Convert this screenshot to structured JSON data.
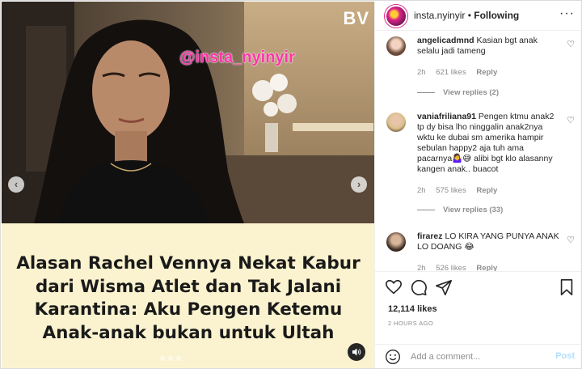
{
  "media": {
    "logo": "BV",
    "watermark": "@insta_nyinyir",
    "headline_lines": [
      "Alasan Rachel Vennya Nekat Kabur",
      "dari Wisma Atlet dan Tak Jalani",
      "Karantina: Aku Pengen Ketemu",
      "Anak-anak bukan untuk Ultah"
    ],
    "arrow_left": "‹",
    "arrow_right": "›",
    "sound_icon": "speaker-icon"
  },
  "header": {
    "username": "insta.nyinyir",
    "separator": "•",
    "follow_state": "Following",
    "more": "···"
  },
  "comments": [
    {
      "user": "angelicadmnd",
      "text": "Kasian bgt anak selalu jadi tameng",
      "age": "2h",
      "likes": "621 likes",
      "reply": "Reply",
      "view_replies": "View replies (2)"
    },
    {
      "user": "vaniafriliana91",
      "text": "Pengen ktmu anak2 tp dy bisa lho ninggalin anak2nya wktu ke dubai sm amerika hampir sebulan happy2 aja tuh ama pacarnya🤷‍♀️😅 alibi bgt klo alasanny kangen anak.. buacot",
      "age": "2h",
      "likes": "575 likes",
      "reply": "Reply",
      "view_replies": "View replies (33)"
    },
    {
      "user": "firarez",
      "text": "LO KIRA YANG PUNYA ANAK LO DOANG 😂",
      "age": "2h",
      "likes": "526 likes",
      "reply": "Reply"
    }
  ],
  "actions": {
    "likes": "12,114 likes",
    "time": "2 HOURS AGO",
    "icons": [
      "heart-icon",
      "comment-icon",
      "share-icon",
      "bookmark-icon"
    ]
  },
  "composer": {
    "placeholder": "Add a comment...",
    "post_label": "Post"
  },
  "colors": {
    "caption_bg": "#fbf3cf",
    "watermark": "#ff33aa",
    "post_disabled": "#b2dffc",
    "muted_text": "#8e8e8e"
  }
}
